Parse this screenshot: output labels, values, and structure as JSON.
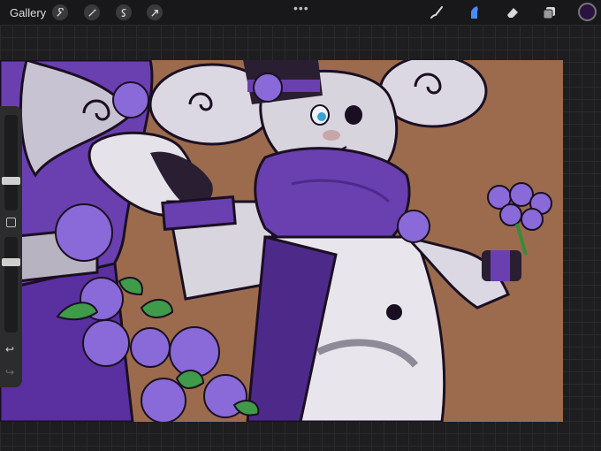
{
  "toolbar": {
    "gallery_label": "Gallery",
    "more_label": "•••"
  },
  "colors": {
    "current_color": "#2a1340",
    "canvas_background": "#9c6b4d",
    "active_tool": "#4a8cff"
  },
  "left_tools": [
    {
      "name": "wrench-icon",
      "tool": "actions"
    },
    {
      "name": "magic-wand-icon",
      "tool": "adjustments"
    },
    {
      "name": "selection-icon",
      "tool": "selection"
    },
    {
      "name": "transform-arrow-icon",
      "tool": "transform"
    }
  ],
  "right_tools": [
    {
      "name": "brush-icon",
      "tool": "paint",
      "active": false
    },
    {
      "name": "smudge-icon",
      "tool": "smudge",
      "active": true
    },
    {
      "name": "eraser-icon",
      "tool": "erase",
      "active": false
    },
    {
      "name": "layers-icon",
      "tool": "layers",
      "active": false
    }
  ],
  "sidebar": {
    "brush_size_level": 0.25,
    "opacity_level": 0.35,
    "undo_symbol": "↩",
    "redo_symbol": "↪"
  }
}
